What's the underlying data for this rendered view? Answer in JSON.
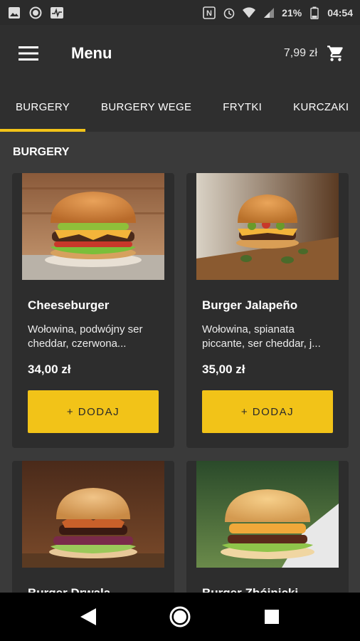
{
  "status_bar": {
    "battery": "21%",
    "time": "04:54",
    "icons_left": [
      "image-icon",
      "circle-icon",
      "activity-icon"
    ],
    "icons_right": [
      "nfc-icon",
      "alarm-icon",
      "wifi-icon",
      "signal-icon",
      "battery-icon"
    ]
  },
  "header": {
    "title": "Menu",
    "cart_amount": "7,99 zł"
  },
  "tabs": [
    {
      "label": "BURGERY",
      "active": true
    },
    {
      "label": "BURGERY WEGE",
      "active": false
    },
    {
      "label": "FRYTKI",
      "active": false
    },
    {
      "label": "KURCZAKI",
      "active": false
    }
  ],
  "section": {
    "title": "BURGERY"
  },
  "products": [
    {
      "name": "Cheeseburger",
      "description": "Wołowina, podwójny ser cheddar, czerwona...",
      "price": "34,00 zł",
      "button": "+ DODAJ"
    },
    {
      "name": "Burger Jalapeño",
      "description": "Wołowina, spianata piccante, ser cheddar, j...",
      "price": "35,00 zł",
      "button": "+ DODAJ"
    },
    {
      "name": "Burger Drwala",
      "description": "",
      "price": "",
      "button": ""
    },
    {
      "name": "Burger Zbójnicki",
      "description": "",
      "price": "",
      "button": ""
    }
  ],
  "colors": {
    "accent": "#f2c318",
    "background": "#3a3a3a",
    "card": "#2d2d2d",
    "bar": "#2f2f2f"
  }
}
